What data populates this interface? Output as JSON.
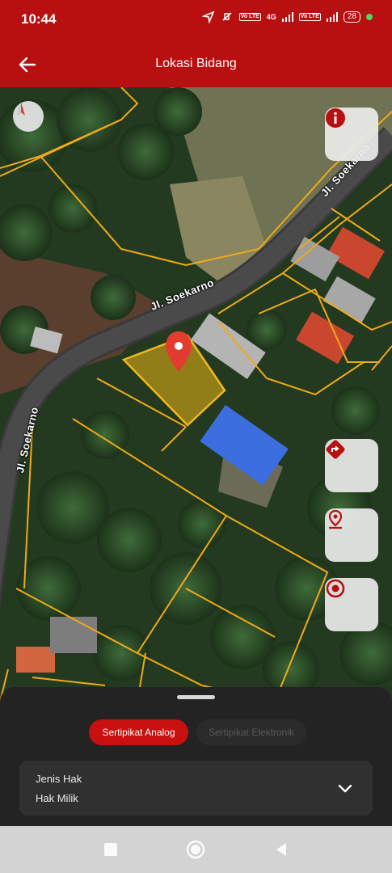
{
  "status_bar": {
    "time": "10:44",
    "battery": "28",
    "signal_tag_1": "Vo LTE",
    "network": "4G",
    "signal_tag_2": "Vo LTE"
  },
  "app_bar": {
    "title": "Lokasi Bidang",
    "back_icon": "arrow-left-icon"
  },
  "map": {
    "road_labels": [
      "Jl. Soekarno",
      "Jl. Soekarno",
      "Jl. Soekarno"
    ],
    "parcel_color": "#f0a91a",
    "selected_parcel_color": "#d7a813",
    "pin_color": "#e23b30",
    "buttons": [
      "info-icon",
      "directions-icon",
      "location-pin-icon",
      "target-icon"
    ]
  },
  "bottom_sheet": {
    "tabs": [
      {
        "label": "Sertipikat Analog",
        "active": true
      },
      {
        "label": "Sertipikat Elektronik",
        "active": false
      }
    ],
    "field": {
      "label": "Jenis Hak",
      "value": "Hak Milik"
    }
  },
  "colors": {
    "primary": "#b80f10",
    "active_tab": "#c8100f",
    "sheet_bg": "#232323"
  }
}
